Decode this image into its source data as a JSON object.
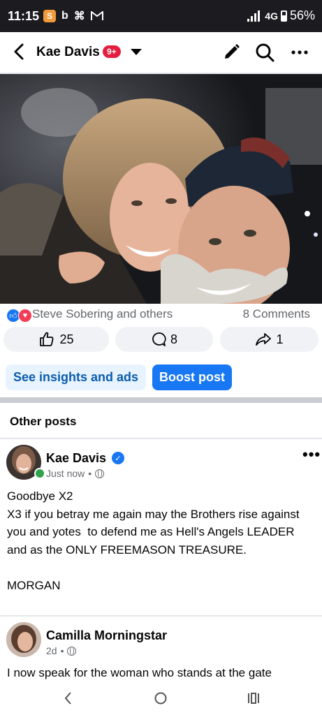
{
  "status_bar": {
    "time": "11:15",
    "network": "4G",
    "battery": "56%"
  },
  "header": {
    "title": "Kae Davis",
    "badge": "9+"
  },
  "post": {
    "reactors": "Steve Sobering and others",
    "comments": "8 Comments",
    "likes": "25",
    "comment_count": "8",
    "shares": "1",
    "insights_label": "See insights and ads",
    "boost_label": "Boost post"
  },
  "section_title": "Other posts",
  "feed": [
    {
      "author": "Kae Davis",
      "time": "Just now",
      "text": "Goodbye X2\nX3 if you betray me again may the Brothers rise against you and yotes  to defend me as Hell's Angels LEADER and as the ONLY FREEMASON TREASURE.\n\nMORGAN"
    },
    {
      "author": "Camilla Morningstar",
      "time": "2d",
      "text": "I now speak for the woman who stands at the gate"
    }
  ],
  "colors": {
    "brand_blue": "#1877f2",
    "status_bar": "#1c1c20",
    "badge_red": "#e41e3f"
  }
}
